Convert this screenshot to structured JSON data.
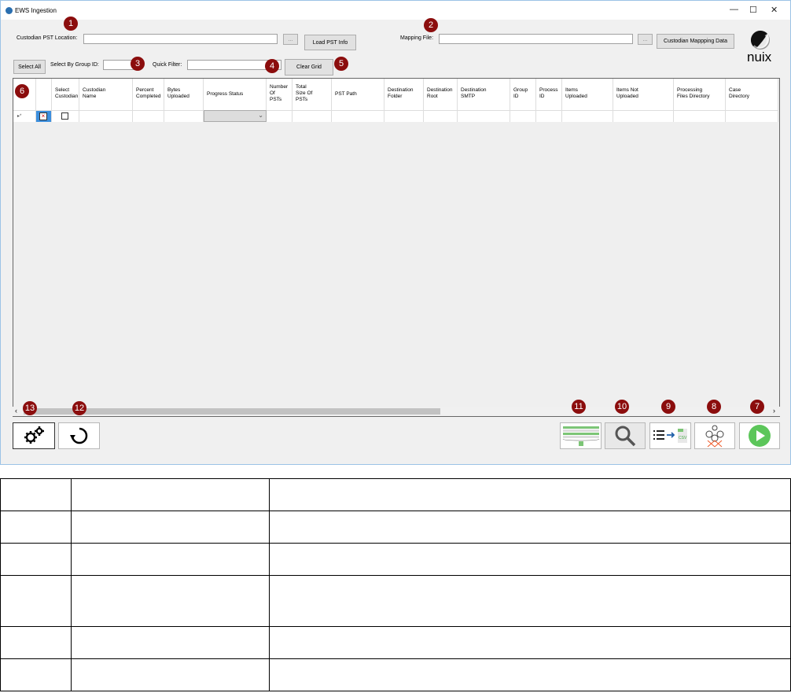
{
  "window": {
    "title": "EWS Ingestion",
    "minimize": "—",
    "maximize": "☐",
    "close": "✕"
  },
  "top": {
    "pst_label": "Custodian PST Location:",
    "pst_value": "",
    "browse": "...",
    "load_pst": "Load PST Info",
    "mapping_label": "Mapping File:",
    "mapping_value": "",
    "mapping_browse": "...",
    "mapping_data": "Custodian Mappping Data",
    "logo": "nuix"
  },
  "filters": {
    "select_all": "Select All",
    "group_label": "Select By Group ID:",
    "group_value": "",
    "quick_label": "Quick Filter:",
    "quick_value": "",
    "clear_grid": "Clear Grid"
  },
  "grid": {
    "columns": [
      "",
      "Select\nCustodian",
      "Custodian\nName",
      "Percent\nCompleted",
      "Bytes\nUploaded",
      "Progress Status",
      "Number\nOf\nPSTs",
      "Total\nSize Of\nPSTs",
      "PST Path",
      "Destination\nFolder",
      "Destination\nRoot",
      "Destination\nSMTP",
      "Group\nID",
      "Process\nID",
      "Items\nUploaded",
      "Items Not\nUploaded",
      "Processing\nFiles Directory",
      "Case\nDirectory"
    ],
    "row_marker": "▸*"
  },
  "badges": [
    "1",
    "2",
    "3",
    "4",
    "5",
    "6",
    "7",
    "8",
    "9",
    "10",
    "11",
    "12",
    "13"
  ],
  "buttons": {
    "settings": "gear-icon",
    "refresh": "refresh-icon",
    "grid_view": "grid-icon",
    "search": "search-icon",
    "export_csv": "list-to-csv-icon",
    "workflow": "workflow-icon",
    "run": "play-icon"
  },
  "legend_table": {
    "rows": [
      [
        "",
        "",
        ""
      ],
      [
        "",
        "",
        ""
      ],
      [
        "",
        "",
        ""
      ],
      [
        "",
        "",
        ""
      ],
      [
        "",
        "",
        ""
      ],
      [
        "",
        "",
        ""
      ]
    ]
  }
}
